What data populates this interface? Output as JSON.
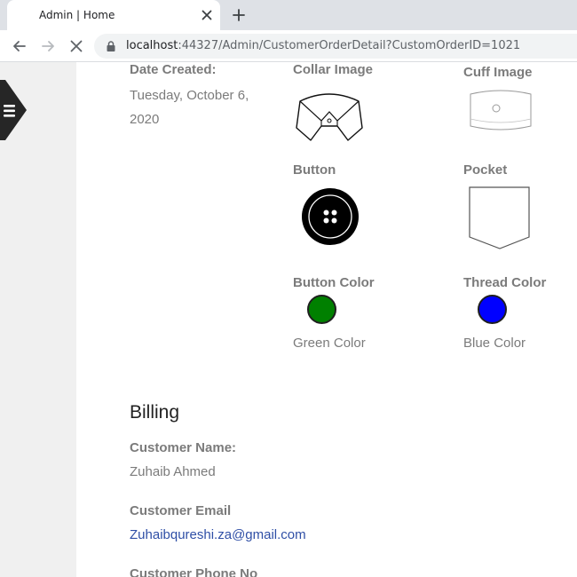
{
  "browser": {
    "tab_title": "Admin | Home",
    "url_host": "localhost",
    "url_path": ":44327/Admin/CustomerOrderDetail?CustomOrderID=1021"
  },
  "order": {
    "date_created_label": "Date Created:",
    "date_created_value": "Tuesday, October 6, 2020",
    "collar_image_label": "Collar Image",
    "cuff_image_label": "Cuff Image",
    "button_label": "Button",
    "pocket_label": "Pocket",
    "button_color_label": "Button Color",
    "button_color_value": "Green Color",
    "button_color_hex": "#008000",
    "thread_color_label": "Thread Color",
    "thread_color_value": "Blue Color",
    "thread_color_hex": "#0000ff"
  },
  "billing": {
    "title": "Billing",
    "customer_name_label": "Customer Name:",
    "customer_name_value": "Zuhaib Ahmed",
    "customer_email_label": "Customer Email",
    "customer_email_value": "Zuhaibqureshi.za@gmail.com",
    "customer_phone_label": "Customer Phone No"
  },
  "icons": {
    "menu": "hamburger-menu-icon",
    "back": "back-arrow-icon",
    "forward": "forward-arrow-icon",
    "stop": "stop-loading-icon",
    "lock": "lock-icon",
    "new_tab": "plus-icon",
    "close_tab": "close-icon"
  }
}
